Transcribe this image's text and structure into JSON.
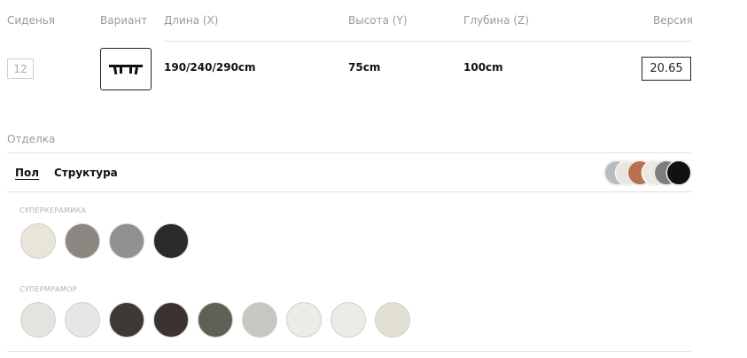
{
  "header": {
    "seats": "Сиденья",
    "variant": "Вариант",
    "length": "Длина (X)",
    "height": "Высота (Y)",
    "depth": "Глубина (Z)",
    "version": "Версия"
  },
  "product": {
    "seats": "12",
    "variant_icon": "table-silhouette-icon",
    "length": "190/240/290cm",
    "height": "75cm",
    "depth": "100cm",
    "version": "20.65"
  },
  "finish": {
    "title": "Отделка",
    "tabs": [
      {
        "label": "Пол",
        "active": true
      },
      {
        "label": "Структура",
        "active": false
      }
    ],
    "preview_colors": [
      "#b9bcbc",
      "#e9e6df",
      "#b8714e",
      "#ece9e2",
      "#7d7d7d",
      "#111111"
    ],
    "groups": [
      {
        "label": "СУПЕРКЕРАМИКА",
        "swatches": [
          "#e9e6d9",
          "#8b8680",
          "#8f9193",
          "#2a2a2b"
        ]
      },
      {
        "label": "СУПЕРМРАМОР",
        "swatches": [
          "#e3e4dd",
          "#e5e6e6",
          "#3f3833",
          "#3a3330",
          "#5d6157",
          "#c7c6c0",
          "#ecebe6",
          "#ecebe6",
          "#e3e0d3"
        ]
      }
    ]
  }
}
